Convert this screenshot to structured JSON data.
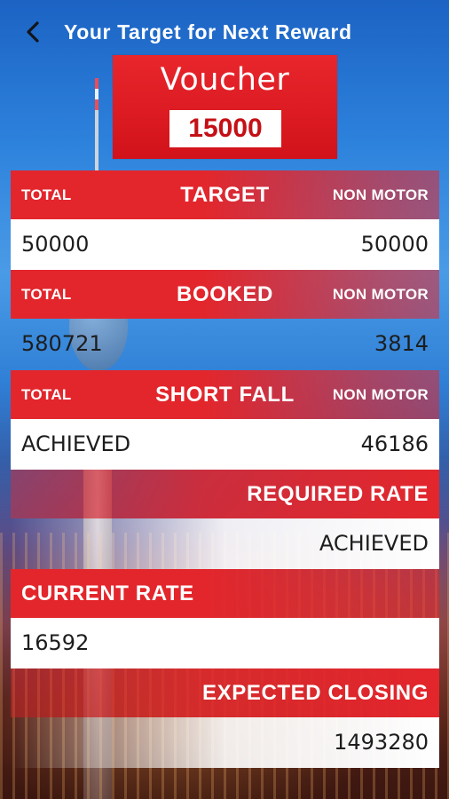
{
  "header": {
    "title": "Your Target for Next Reward",
    "back_icon": "arrow-left-icon"
  },
  "voucher": {
    "label": "Voucher",
    "amount": "15000"
  },
  "target": {
    "total_label": "TOTAL",
    "heading": "TARGET",
    "non_motor_label": "NON MOTOR",
    "total_value": "50000",
    "non_motor_value": "50000"
  },
  "booked": {
    "total_label": "TOTAL",
    "heading": "BOOKED",
    "non_motor_label": "NON MOTOR",
    "total_value": "580721",
    "non_motor_value": "3814"
  },
  "short_fall": {
    "total_label": "TOTAL",
    "heading": "SHORT FALL",
    "non_motor_label": "NON MOTOR",
    "total_value": "ACHIEVED",
    "non_motor_value": "46186"
  },
  "required_rate": {
    "heading": "REQUIRED RATE",
    "value": "ACHIEVED"
  },
  "current_rate": {
    "heading": "CURRENT RATE",
    "value": "16592"
  },
  "expected_closing": {
    "heading": "EXPECTED CLOSING",
    "value": "1493280"
  },
  "colors": {
    "accent_red": "#e3262c",
    "text_dark": "#1d1d1d",
    "white": "#ffffff"
  }
}
